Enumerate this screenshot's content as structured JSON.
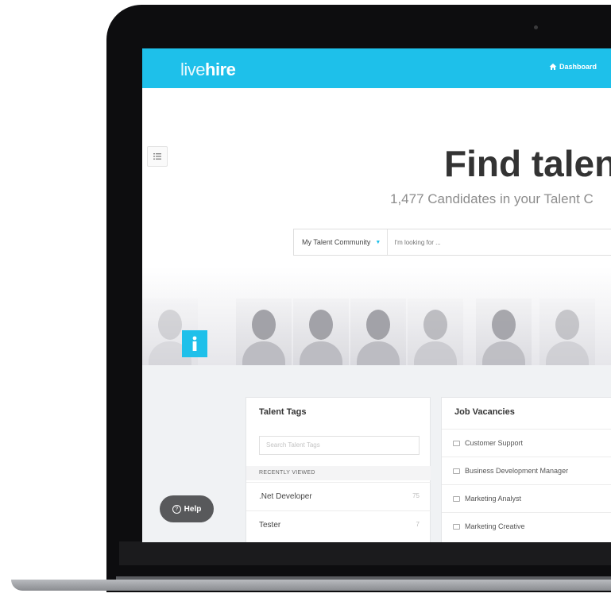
{
  "header": {
    "logo_light": "live",
    "logo_bold": "hire",
    "nav_dashboard": "Dashboard"
  },
  "hero": {
    "title": "Find talen",
    "subtitle": "1,477 Candidates in your Talent C"
  },
  "search": {
    "community_label": "My Talent Community",
    "placeholder": "I'm looking for ..."
  },
  "talent_tags": {
    "title": "Talent Tags",
    "search_placeholder": "Search Talent Tags",
    "recent_label": "RECENTLY VIEWED",
    "items": [
      {
        "label": ".Net Developer",
        "count": "75"
      },
      {
        "label": "Tester",
        "count": "7"
      }
    ]
  },
  "job_vacancies": {
    "title": "Job Vacancies",
    "items": [
      {
        "label": "Customer Support"
      },
      {
        "label": "Business Development Manager"
      },
      {
        "label": "Marketing Analyst"
      },
      {
        "label": "Marketing Creative"
      }
    ]
  },
  "help": {
    "label": "Help"
  },
  "icons": {
    "dashboard": "home-icon",
    "menu": "list-icon",
    "info": "info-icon",
    "help": "question-icon",
    "job": "briefcase-icon"
  },
  "colors": {
    "brand": "#1ec0ea",
    "help_button": "#58595b"
  }
}
